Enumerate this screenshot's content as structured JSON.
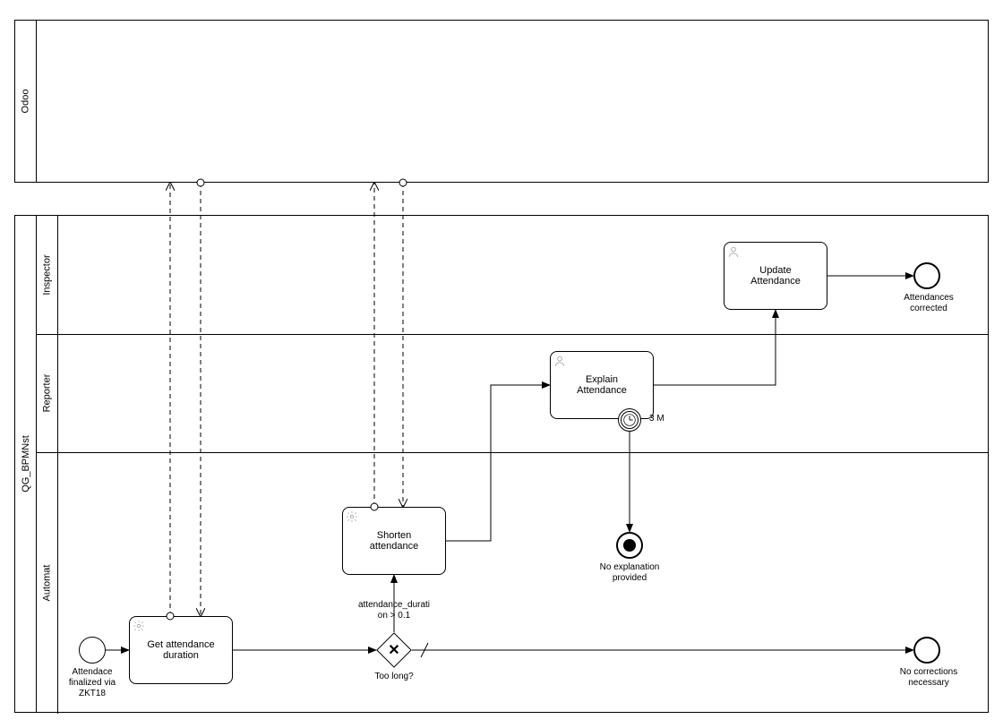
{
  "pools": {
    "odoo": {
      "label": "Odoo"
    },
    "qg": {
      "label": "QG_BPMNst"
    }
  },
  "lanes": {
    "inspector": {
      "label": "Inspector"
    },
    "reporter": {
      "label": "Reporter"
    },
    "automat": {
      "label": "Automat"
    }
  },
  "tasks": {
    "get_duration": {
      "label": "Get attendance\nduration"
    },
    "shorten": {
      "label": "Shorten\nattendance"
    },
    "explain": {
      "label": "Explain\nAttendance"
    },
    "update": {
      "label": "Update\nAttendance"
    }
  },
  "gateways": {
    "too_long": {
      "label": "Too long?"
    }
  },
  "events": {
    "start": {
      "label": "Attendace\nfinalized via\nZKT18"
    },
    "end_no_corrections": {
      "label": "No corrections\nnecessary"
    },
    "end_corrected": {
      "label": "Attendances\ncorrected"
    },
    "end_no_expl": {
      "label": "No explanation\nprovided"
    },
    "timer": {
      "label": "3 M"
    }
  },
  "edges": {
    "cond_duration": {
      "label": "attendance_durati\non > 0.1"
    }
  }
}
